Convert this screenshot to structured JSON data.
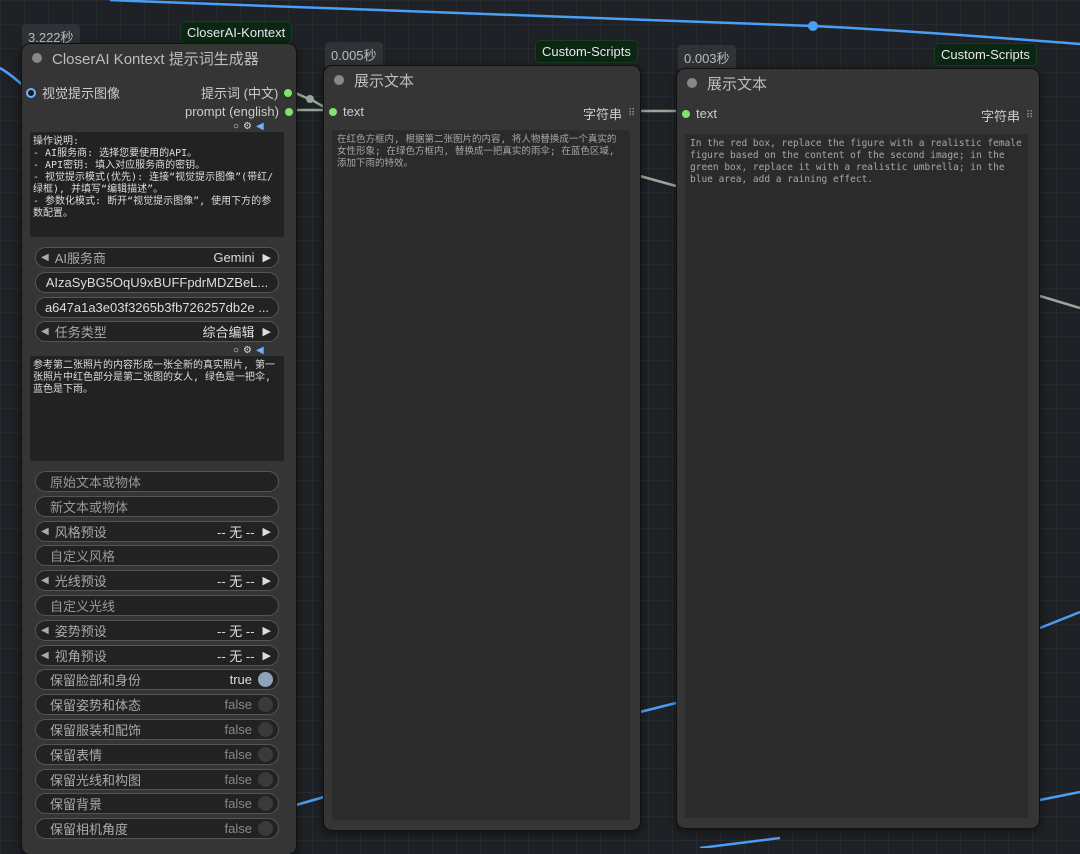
{
  "colors": {
    "accent_link": "#4a9ff5",
    "grey_link": "#9aa69a",
    "socket_green": "#7fe46c",
    "tag_bg": "#0b2613"
  },
  "node1": {
    "time": "3.222秒",
    "tag": "CloserAI-Kontext",
    "title": "CloserAI Kontext 提示词生成器",
    "input_label": "视觉提示图像",
    "output1": "提示词 (中文)",
    "output2": "prompt (english)",
    "instructions": "操作说明:\n- AI服务商: 选择您要使用的API。\n- API密钥: 填入对应服务商的密钥。\n- 视觉提示模式(优先): 连接“视觉提示图像”(带红/绿框), 并填写“编辑描述”。\n- 参数化模式: 断开“视觉提示图像”, 使用下方的参数配置。",
    "ai_provider_label": "AI服务商",
    "ai_provider_value": "Gemini",
    "api_key": "AIzaSyBG5OqU9xBUFFpdrMDZBeL...",
    "api_key2": "a647a1a3e03f3265b3fb726257db2e ...",
    "task_label": "任务类型",
    "task_value": "综合编辑",
    "edit_desc": "参考第二张照片的内容形成一张全新的真实照片, 第一张照片中红色部分是第二张图的女人, 绿色是一把伞, 蓝色是下雨。",
    "orig_text_ph": "原始文本或物体",
    "new_text_ph": "新文本或物体",
    "style_label": "风格预设",
    "style_value": "-- 无 --",
    "custom_style_ph": "自定义风格",
    "light_label": "光线预设",
    "light_value": "-- 无 --",
    "custom_light_ph": "自定义光线",
    "pose_label": "姿势预设",
    "pose_value": "-- 无 --",
    "view_label": "视角预设",
    "view_value": "-- 无 --",
    "keep_face_label": "保留脸部和身份",
    "keep_face_value": "true",
    "keep_pose_label": "保留姿势和体态",
    "keep_pose_value": "false",
    "keep_clothes_label": "保留服装和配饰",
    "keep_clothes_value": "false",
    "keep_expr_label": "保留表情",
    "keep_expr_value": "false",
    "keep_light_label": "保留光线和构图",
    "keep_light_value": "false",
    "keep_bg_label": "保留背景",
    "keep_bg_value": "false",
    "keep_cam_label": "保留相机角度",
    "keep_cam_value": "false"
  },
  "node2": {
    "time": "0.005秒",
    "tag": "Custom-Scripts",
    "title": "展示文本",
    "input_label": "text",
    "output_label": "字符串",
    "text": "在红色方框内, 根据第二张图片的内容, 将人物替换成一个真实的女性形象; 在绿色方框内, 替换成一把真实的雨伞; 在蓝色区域, 添加下雨的特效。"
  },
  "node3": {
    "time": "0.003秒",
    "tag": "Custom-Scripts",
    "title": "展示文本",
    "input_label": "text",
    "output_label": "字符串",
    "text": "In the red box, replace the figure with a realistic female figure based on the content of the second image; in the green box, replace it with a realistic umbrella; in the blue area, add a raining effect."
  }
}
